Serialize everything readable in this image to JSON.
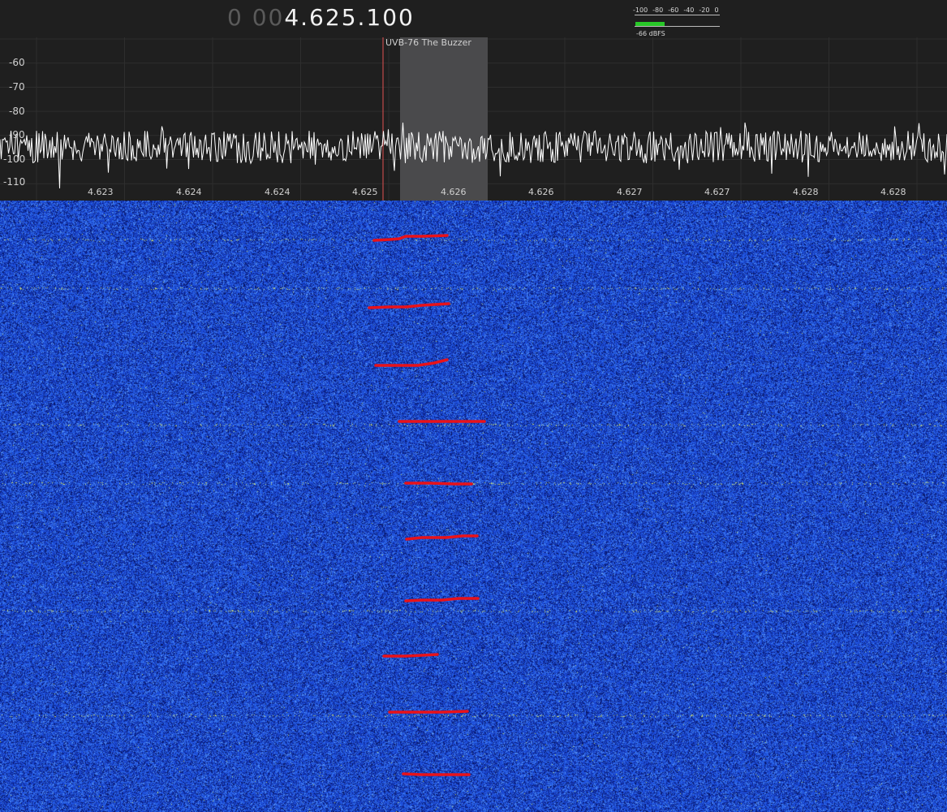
{
  "frequency": {
    "dim_digits": "0 00",
    "main_digits": "4.625.100"
  },
  "meter": {
    "scale": [
      "-100",
      "-80",
      "-60",
      "-40",
      "-20",
      "0"
    ],
    "reading": "-66 dBFS",
    "level_dbfs": -66
  },
  "spectrum": {
    "y_labels": [
      "-60",
      "-70",
      "-80",
      "-90",
      "-100",
      "-110"
    ],
    "x_labels": [
      "4.623",
      "4.624",
      "4.624",
      "4.625",
      "4.626",
      "4.626",
      "4.627",
      "4.627",
      "4.628",
      "4.628"
    ],
    "bookmark_label": "UVB-76 The Buzzer",
    "colors": {
      "background": "#1f1f1f",
      "trace": "#ffffff",
      "grid": "#2e2e2e",
      "band": "#4a4a4c",
      "tuning_line": "#e05050"
    }
  },
  "waterfall": {
    "colors": {
      "base": "#1e4fd8",
      "dark": "#0b1e6e",
      "light": "#5a8af0",
      "annotation": "#e8121a",
      "signal": "#c8e060"
    },
    "annotations": [
      {
        "x": [
          461,
          480,
          492,
          500,
          520,
          551
        ],
        "y": [
          296,
          295,
          294,
          291,
          291,
          290
        ]
      },
      {
        "x": [
          455,
          480,
          500,
          520,
          553
        ],
        "y": [
          379,
          378,
          378,
          376,
          374
        ]
      },
      {
        "x": [
          463,
          490,
          515,
          535,
          551
        ],
        "y": [
          450,
          450,
          450,
          447,
          443
        ]
      },
      {
        "x": [
          492,
          520,
          550,
          597
        ],
        "y": [
          519,
          519,
          519,
          519
        ]
      },
      {
        "x": [
          500,
          530,
          560,
          581
        ],
        "y": [
          595,
          595,
          596,
          596
        ]
      },
      {
        "x": [
          501,
          520,
          550,
          570,
          588
        ],
        "y": [
          664,
          662,
          662,
          660,
          660
        ]
      },
      {
        "x": [
          500,
          520,
          545,
          565,
          589
        ],
        "y": [
          740,
          739,
          739,
          737,
          737
        ]
      },
      {
        "x": [
          473,
          500,
          520,
          539
        ],
        "y": [
          808,
          808,
          807,
          806
        ]
      },
      {
        "x": [
          480,
          510,
          545,
          576
        ],
        "y": [
          877,
          877,
          877,
          876
        ]
      },
      {
        "x": [
          497,
          520,
          550,
          578
        ],
        "y": [
          953,
          954,
          954,
          954
        ]
      }
    ]
  }
}
